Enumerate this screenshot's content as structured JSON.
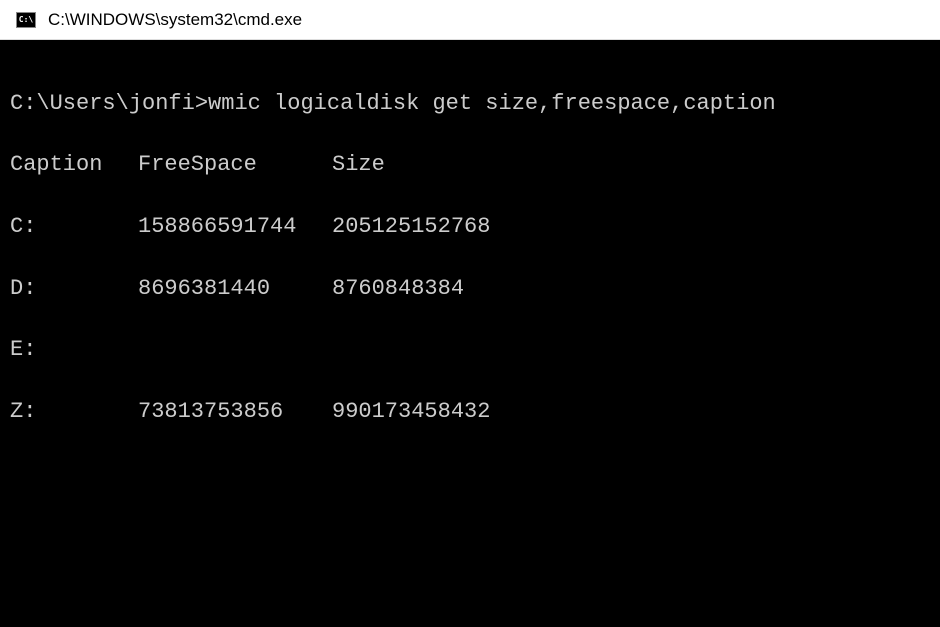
{
  "window": {
    "icon_label": "C:\\",
    "title": "C:\\WINDOWS\\system32\\cmd.exe"
  },
  "terminal": {
    "prompt": "C:\\Users\\jonfi>",
    "command": "wmic logicaldisk get size,freespace,caption",
    "headers": {
      "caption": "Caption",
      "freespace": "FreeSpace",
      "size": "Size"
    },
    "rows": [
      {
        "caption": "C:",
        "freespace": "158866591744",
        "size": "205125152768"
      },
      {
        "caption": "D:",
        "freespace": "8696381440",
        "size": "8760848384"
      },
      {
        "caption": "E:",
        "freespace": "",
        "size": ""
      },
      {
        "caption": "Z:",
        "freespace": "73813753856",
        "size": "990173458432"
      }
    ]
  }
}
